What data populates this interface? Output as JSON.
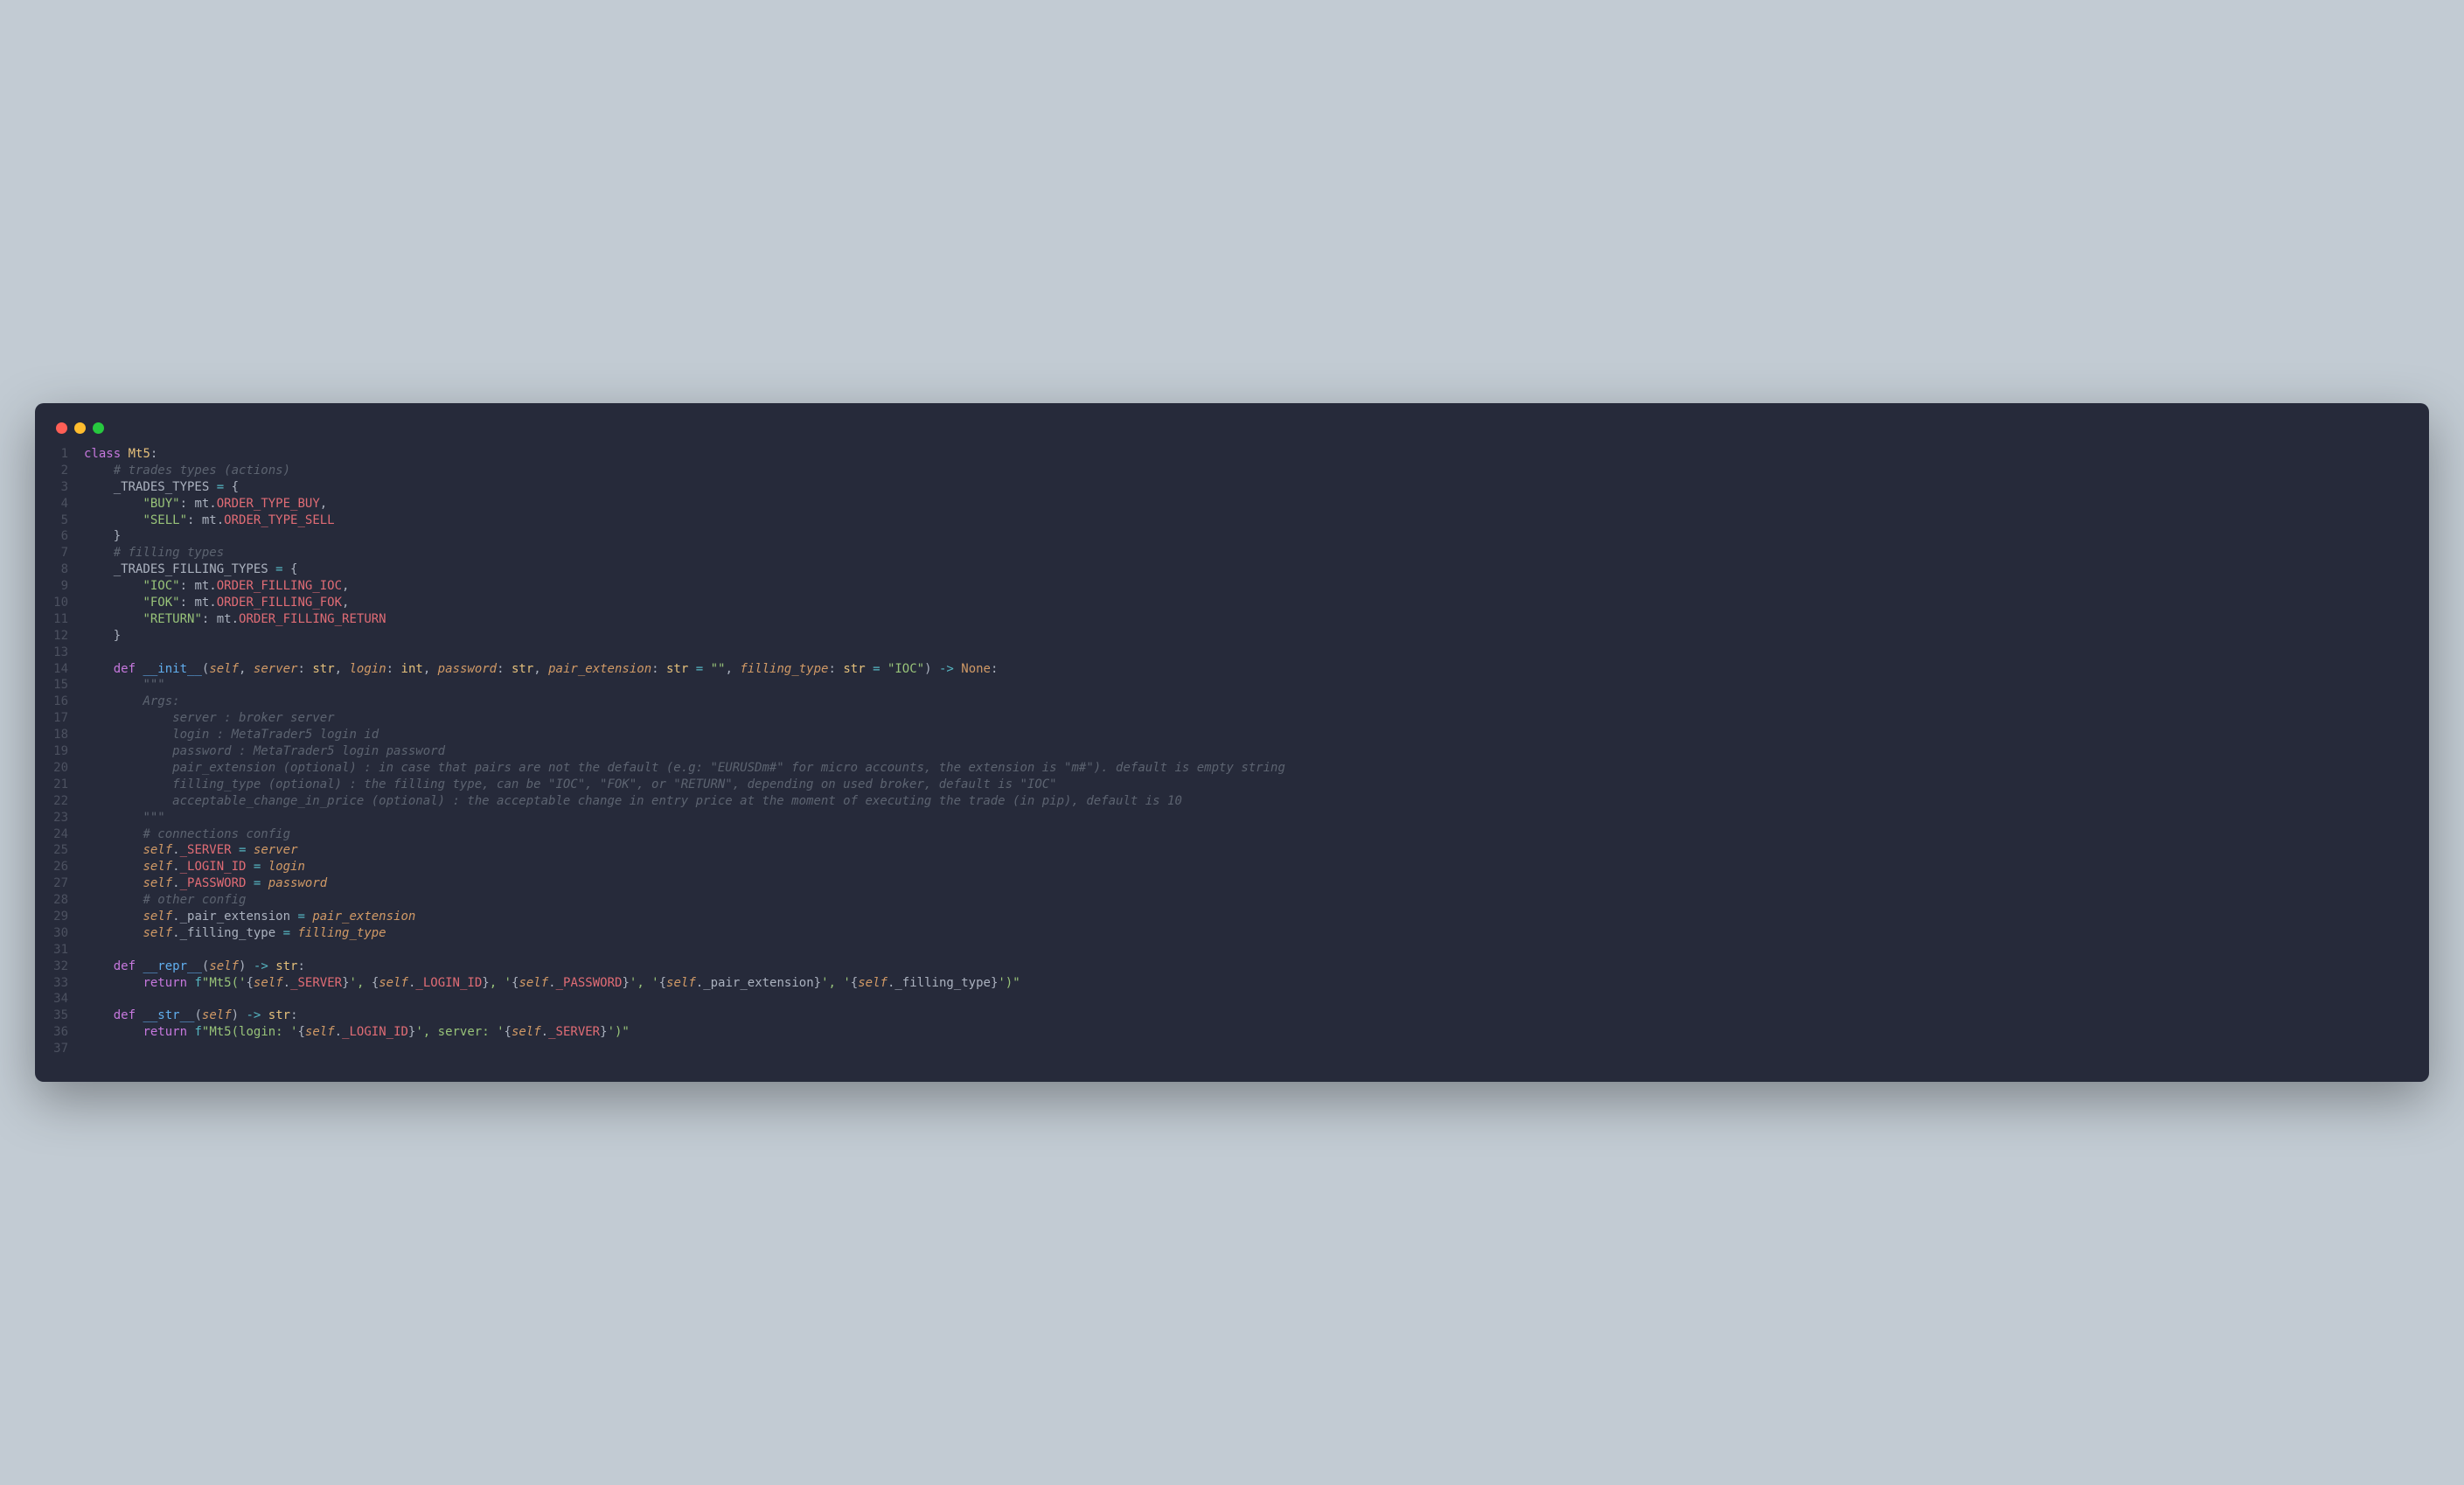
{
  "window": {
    "traffic_lights": [
      "close",
      "minimize",
      "zoom"
    ]
  },
  "colors": {
    "keyword": "#c678dd",
    "class": "#e5c07b",
    "function": "#61afef",
    "param": "#d19a66",
    "string": "#98c379",
    "comment": "#5c6370",
    "operator": "#56b6c2",
    "punct": "#abb2bf",
    "member": "#e06c75",
    "bg": "#262a3a",
    "page_bg": "#c2cbd3"
  },
  "lines": [
    {
      "n": "1",
      "tokens": [
        [
          "kw",
          "class"
        ],
        [
          "pun",
          " "
        ],
        [
          "cls",
          "Mt5"
        ],
        [
          "pun",
          ":"
        ]
      ]
    },
    {
      "n": "2",
      "tokens": [
        [
          "pun",
          "    "
        ],
        [
          "cmt",
          "# trades types (actions)"
        ]
      ]
    },
    {
      "n": "3",
      "tokens": [
        [
          "pun",
          "    _TRADES_TYPES "
        ],
        [
          "op",
          "="
        ],
        [
          "pun",
          " {"
        ]
      ]
    },
    {
      "n": "4",
      "tokens": [
        [
          "pun",
          "        "
        ],
        [
          "str",
          "\"BUY\""
        ],
        [
          "pun",
          ": mt."
        ],
        [
          "mem",
          "ORDER_TYPE_BUY"
        ],
        [
          "pun",
          ","
        ]
      ]
    },
    {
      "n": "5",
      "tokens": [
        [
          "pun",
          "        "
        ],
        [
          "str",
          "\"SELL\""
        ],
        [
          "pun",
          ": mt."
        ],
        [
          "mem",
          "ORDER_TYPE_SELL"
        ]
      ]
    },
    {
      "n": "6",
      "tokens": [
        [
          "pun",
          "    }"
        ]
      ]
    },
    {
      "n": "7",
      "tokens": [
        [
          "pun",
          "    "
        ],
        [
          "cmt",
          "# filling types"
        ]
      ]
    },
    {
      "n": "8",
      "tokens": [
        [
          "pun",
          "    _TRADES_FILLING_TYPES "
        ],
        [
          "op",
          "="
        ],
        [
          "pun",
          " {"
        ]
      ]
    },
    {
      "n": "9",
      "tokens": [
        [
          "pun",
          "        "
        ],
        [
          "str",
          "\"IOC\""
        ],
        [
          "pun",
          ": mt."
        ],
        [
          "mem",
          "ORDER_FILLING_IOC"
        ],
        [
          "pun",
          ","
        ]
      ]
    },
    {
      "n": "10",
      "tokens": [
        [
          "pun",
          "        "
        ],
        [
          "str",
          "\"FOK\""
        ],
        [
          "pun",
          ": mt."
        ],
        [
          "mem",
          "ORDER_FILLING_FOK"
        ],
        [
          "pun",
          ","
        ]
      ]
    },
    {
      "n": "11",
      "tokens": [
        [
          "pun",
          "        "
        ],
        [
          "str",
          "\"RETURN\""
        ],
        [
          "pun",
          ": mt."
        ],
        [
          "mem",
          "ORDER_FILLING_RETURN"
        ]
      ]
    },
    {
      "n": "12",
      "tokens": [
        [
          "pun",
          "    }"
        ]
      ]
    },
    {
      "n": "13",
      "tokens": [
        [
          "pun",
          ""
        ]
      ]
    },
    {
      "n": "14",
      "tokens": [
        [
          "pun",
          "    "
        ],
        [
          "kw",
          "def"
        ],
        [
          "pun",
          " "
        ],
        [
          "fn",
          "__init__"
        ],
        [
          "pun",
          "("
        ],
        [
          "prm",
          "self"
        ],
        [
          "pun",
          ", "
        ],
        [
          "prm",
          "server"
        ],
        [
          "pun",
          ": "
        ],
        [
          "cls",
          "str"
        ],
        [
          "pun",
          ", "
        ],
        [
          "prm",
          "login"
        ],
        [
          "pun",
          ": "
        ],
        [
          "cls",
          "int"
        ],
        [
          "pun",
          ", "
        ],
        [
          "prm",
          "password"
        ],
        [
          "pun",
          ": "
        ],
        [
          "cls",
          "str"
        ],
        [
          "pun",
          ", "
        ],
        [
          "prm",
          "pair_extension"
        ],
        [
          "pun",
          ": "
        ],
        [
          "cls",
          "str"
        ],
        [
          "pun",
          " "
        ],
        [
          "op",
          "="
        ],
        [
          "pun",
          " "
        ],
        [
          "str",
          "\"\""
        ],
        [
          "pun",
          ", "
        ],
        [
          "prm",
          "filling_type"
        ],
        [
          "pun",
          ": "
        ],
        [
          "cls",
          "str"
        ],
        [
          "pun",
          " "
        ],
        [
          "op",
          "="
        ],
        [
          "pun",
          " "
        ],
        [
          "str",
          "\"IOC\""
        ],
        [
          "pun",
          ") "
        ],
        [
          "op",
          "->"
        ],
        [
          "pun",
          " "
        ],
        [
          "const",
          "None"
        ],
        [
          "pun",
          ":"
        ]
      ]
    },
    {
      "n": "15",
      "tokens": [
        [
          "pun",
          "        "
        ],
        [
          "cmt",
          "\"\"\""
        ]
      ]
    },
    {
      "n": "16",
      "tokens": [
        [
          "pun",
          "        "
        ],
        [
          "cmt",
          "Args:"
        ]
      ]
    },
    {
      "n": "17",
      "tokens": [
        [
          "pun",
          "            "
        ],
        [
          "cmt",
          "server : broker server"
        ]
      ]
    },
    {
      "n": "18",
      "tokens": [
        [
          "pun",
          "            "
        ],
        [
          "cmt",
          "login : MetaTrader5 login id"
        ]
      ]
    },
    {
      "n": "19",
      "tokens": [
        [
          "pun",
          "            "
        ],
        [
          "cmt",
          "password : MetaTrader5 login password"
        ]
      ]
    },
    {
      "n": "20",
      "tokens": [
        [
          "pun",
          "            "
        ],
        [
          "cmt",
          "pair_extension (optional) : in case that pairs are not the default (e.g: \"EURUSDm#\" for micro accounts, the extension is \"m#\"). default is empty string"
        ]
      ]
    },
    {
      "n": "21",
      "tokens": [
        [
          "pun",
          "            "
        ],
        [
          "cmt",
          "filling_type (optional) : the filling type, can be \"IOC\", \"FOK\", or \"RETURN\", depending on used broker, default is \"IOC\""
        ]
      ]
    },
    {
      "n": "22",
      "tokens": [
        [
          "pun",
          "            "
        ],
        [
          "cmt",
          "acceptable_change_in_price (optional) : the acceptable change in entry price at the moment of executing the trade (in pip), default is 10"
        ]
      ]
    },
    {
      "n": "23",
      "tokens": [
        [
          "pun",
          "        "
        ],
        [
          "cmt",
          "\"\"\""
        ]
      ]
    },
    {
      "n": "24",
      "tokens": [
        [
          "pun",
          "        "
        ],
        [
          "cmt",
          "# connections config"
        ]
      ]
    },
    {
      "n": "25",
      "tokens": [
        [
          "pun",
          "        "
        ],
        [
          "prm",
          "self"
        ],
        [
          "pun",
          "."
        ],
        [
          "mem",
          "_SERVER"
        ],
        [
          "pun",
          " "
        ],
        [
          "op",
          "="
        ],
        [
          "pun",
          " "
        ],
        [
          "prm",
          "server"
        ]
      ]
    },
    {
      "n": "26",
      "tokens": [
        [
          "pun",
          "        "
        ],
        [
          "prm",
          "self"
        ],
        [
          "pun",
          "."
        ],
        [
          "mem",
          "_LOGIN_ID"
        ],
        [
          "pun",
          " "
        ],
        [
          "op",
          "="
        ],
        [
          "pun",
          " "
        ],
        [
          "prm",
          "login"
        ]
      ]
    },
    {
      "n": "27",
      "tokens": [
        [
          "pun",
          "        "
        ],
        [
          "prm",
          "self"
        ],
        [
          "pun",
          "."
        ],
        [
          "mem",
          "_PASSWORD"
        ],
        [
          "pun",
          " "
        ],
        [
          "op",
          "="
        ],
        [
          "pun",
          " "
        ],
        [
          "prm",
          "password"
        ]
      ]
    },
    {
      "n": "28",
      "tokens": [
        [
          "pun",
          "        "
        ],
        [
          "cmt",
          "# other config"
        ]
      ]
    },
    {
      "n": "29",
      "tokens": [
        [
          "pun",
          "        "
        ],
        [
          "prm",
          "self"
        ],
        [
          "pun",
          "._pair_extension "
        ],
        [
          "op",
          "="
        ],
        [
          "pun",
          " "
        ],
        [
          "prm",
          "pair_extension"
        ]
      ]
    },
    {
      "n": "30",
      "tokens": [
        [
          "pun",
          "        "
        ],
        [
          "prm",
          "self"
        ],
        [
          "pun",
          "._filling_type "
        ],
        [
          "op",
          "="
        ],
        [
          "pun",
          " "
        ],
        [
          "prm",
          "filling_type"
        ]
      ]
    },
    {
      "n": "31",
      "tokens": [
        [
          "pun",
          ""
        ]
      ]
    },
    {
      "n": "32",
      "tokens": [
        [
          "pun",
          "    "
        ],
        [
          "kw",
          "def"
        ],
        [
          "pun",
          " "
        ],
        [
          "fn",
          "__repr__"
        ],
        [
          "pun",
          "("
        ],
        [
          "prm",
          "self"
        ],
        [
          "pun",
          ") "
        ],
        [
          "op",
          "->"
        ],
        [
          "pun",
          " "
        ],
        [
          "cls",
          "str"
        ],
        [
          "pun",
          ":"
        ]
      ]
    },
    {
      "n": "33",
      "tokens": [
        [
          "pun",
          "        "
        ],
        [
          "kw",
          "return"
        ],
        [
          "pun",
          " "
        ],
        [
          "op",
          "f"
        ],
        [
          "str",
          "\"Mt5('"
        ],
        [
          "pun",
          "{"
        ],
        [
          "prm",
          "self"
        ],
        [
          "pun",
          "."
        ],
        [
          "mem",
          "_SERVER"
        ],
        [
          "pun",
          "}"
        ],
        [
          "str",
          "', "
        ],
        [
          "pun",
          "{"
        ],
        [
          "prm",
          "self"
        ],
        [
          "pun",
          "."
        ],
        [
          "mem",
          "_LOGIN_ID"
        ],
        [
          "pun",
          "}"
        ],
        [
          "str",
          ", '"
        ],
        [
          "pun",
          "{"
        ],
        [
          "prm",
          "self"
        ],
        [
          "pun",
          "."
        ],
        [
          "mem",
          "_PASSWORD"
        ],
        [
          "pun",
          "}"
        ],
        [
          "str",
          "', '"
        ],
        [
          "pun",
          "{"
        ],
        [
          "prm",
          "self"
        ],
        [
          "pun",
          "._pair_extension}"
        ],
        [
          "str",
          "', '"
        ],
        [
          "pun",
          "{"
        ],
        [
          "prm",
          "self"
        ],
        [
          "pun",
          "._filling_type}"
        ],
        [
          "str",
          "')\""
        ]
      ]
    },
    {
      "n": "34",
      "tokens": [
        [
          "pun",
          ""
        ]
      ]
    },
    {
      "n": "35",
      "tokens": [
        [
          "pun",
          "    "
        ],
        [
          "kw",
          "def"
        ],
        [
          "pun",
          " "
        ],
        [
          "fn",
          "__str__"
        ],
        [
          "pun",
          "("
        ],
        [
          "prm",
          "self"
        ],
        [
          "pun",
          ") "
        ],
        [
          "op",
          "->"
        ],
        [
          "pun",
          " "
        ],
        [
          "cls",
          "str"
        ],
        [
          "pun",
          ":"
        ]
      ]
    },
    {
      "n": "36",
      "tokens": [
        [
          "pun",
          "        "
        ],
        [
          "kw",
          "return"
        ],
        [
          "pun",
          " "
        ],
        [
          "op",
          "f"
        ],
        [
          "str",
          "\"Mt5(login: '"
        ],
        [
          "pun",
          "{"
        ],
        [
          "prm",
          "self"
        ],
        [
          "pun",
          "."
        ],
        [
          "mem",
          "_LOGIN_ID"
        ],
        [
          "pun",
          "}"
        ],
        [
          "str",
          "', server: '"
        ],
        [
          "pun",
          "{"
        ],
        [
          "prm",
          "self"
        ],
        [
          "pun",
          "."
        ],
        [
          "mem",
          "_SERVER"
        ],
        [
          "pun",
          "}"
        ],
        [
          "str",
          "')\""
        ]
      ]
    },
    {
      "n": "37",
      "tokens": [
        [
          "pun",
          ""
        ]
      ]
    }
  ]
}
